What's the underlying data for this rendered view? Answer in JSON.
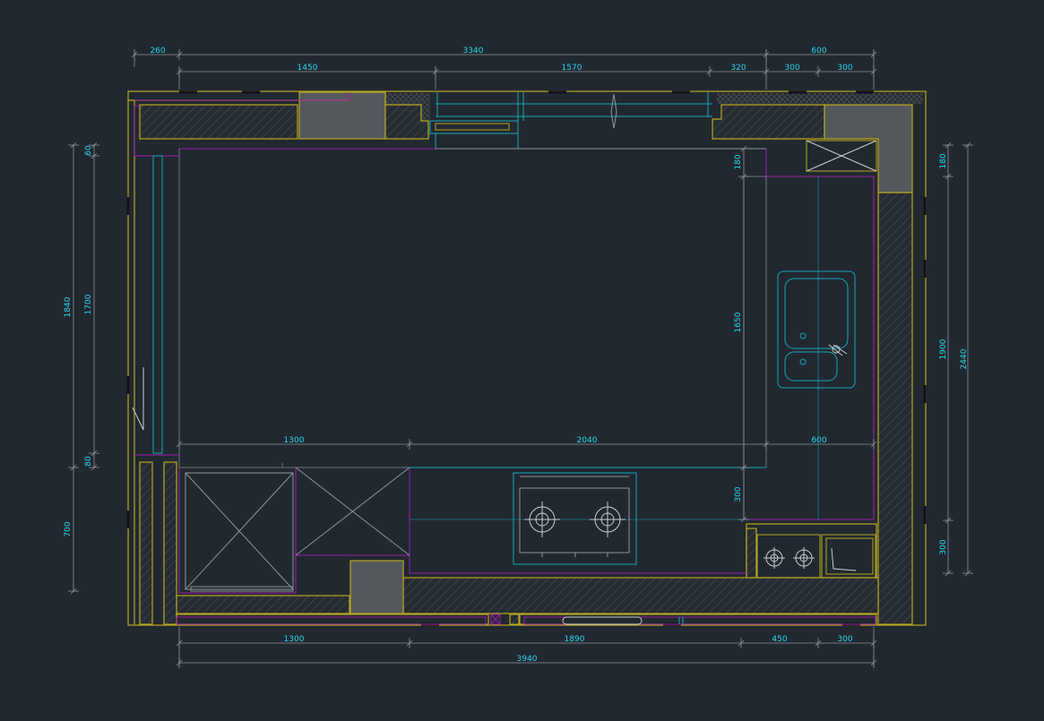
{
  "colors": {
    "background": "#212830",
    "wall": "#b8a81e",
    "cabinet": "#a01fa8",
    "fixture": "#18a8b8",
    "dimension": "#8e959c",
    "dim_text": "#2ad8e8",
    "fill_gray": "#54585c",
    "hatch": "#3a3f44"
  },
  "dimensions": {
    "top_outer": {
      "left": "260",
      "main": "3340",
      "right": "600"
    },
    "top_inner": [
      "1450",
      "1570",
      "320",
      "300",
      "300"
    ],
    "left_outer": [
      "1840",
      "700"
    ],
    "left_inner": [
      "60",
      "1700",
      "80"
    ],
    "right_outer": "2440",
    "right_inner": [
      "180",
      "1900",
      "300"
    ],
    "interior_horizontal": [
      "1300",
      "2040",
      "600"
    ],
    "interior_vertical": [
      "180",
      "1650",
      "300"
    ],
    "bottom_inner": [
      "1300",
      "1890",
      "450",
      "300"
    ],
    "bottom_outer": "3940"
  },
  "fixtures": [
    {
      "name": "double-sink-icon",
      "kind": "sink"
    },
    {
      "name": "stove-icon",
      "kind": "two-burner cooktop"
    },
    {
      "name": "small-cooktop-icon",
      "kind": "two-burner cooktop"
    },
    {
      "name": "appliance-box-icon",
      "kind": "appliance"
    }
  ]
}
